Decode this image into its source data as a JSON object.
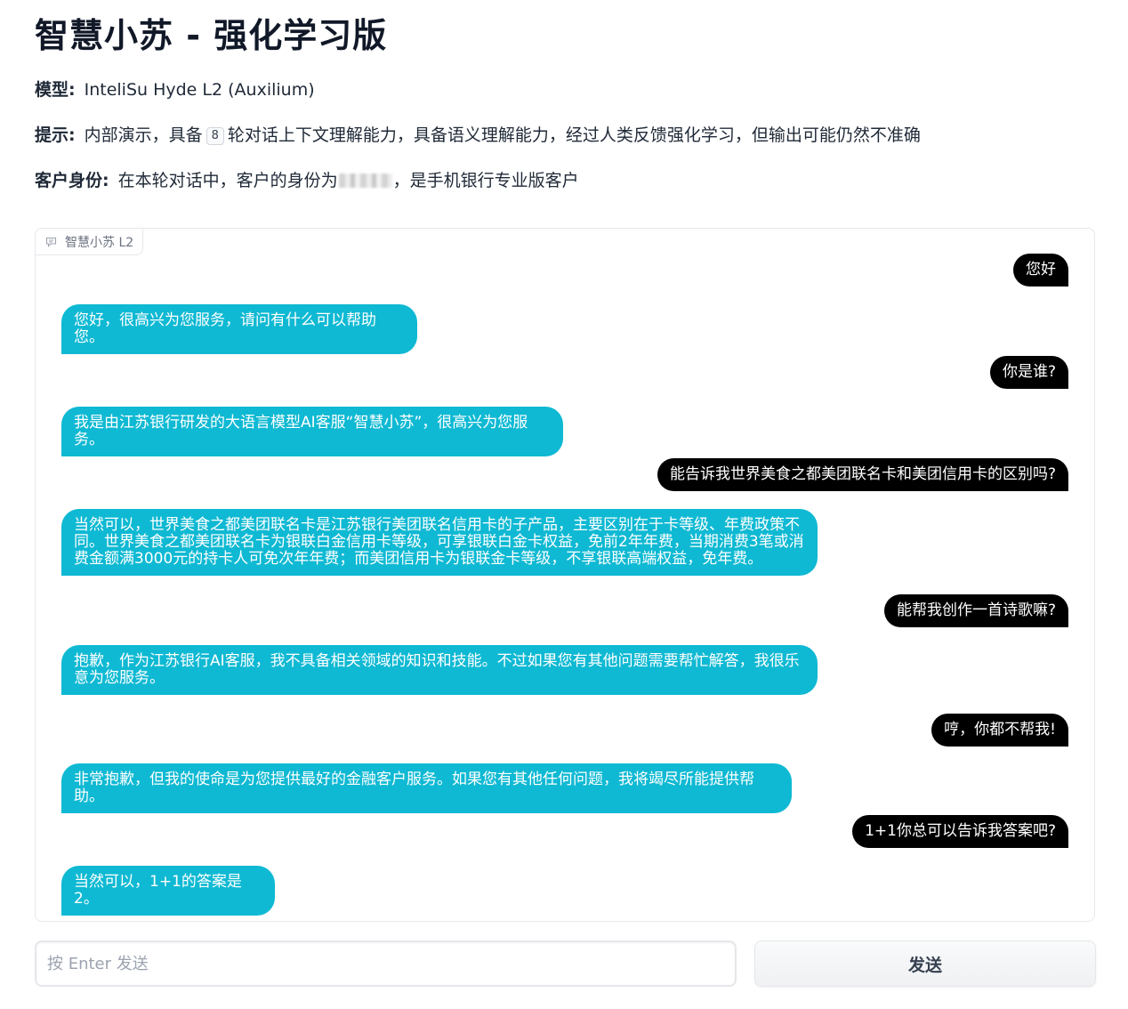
{
  "page": {
    "title": "智慧小苏 - 强化学习版"
  },
  "info": {
    "model_label": "模型:",
    "model_value": "InteliSu Hyde L2 (Auxilium)",
    "hint_label": "提示:",
    "hint_prefix": "内部演示，具备",
    "hint_turns": "8",
    "hint_suffix": "轮对话上下文理解能力，具备语义理解能力，经过人类反馈强化学习，但输出可能仍然不准确",
    "identity_label": "客户身份:",
    "identity_prefix": "在本轮对话中，客户的身份为",
    "identity_suffix": "，是手机银行专业版客户"
  },
  "chat": {
    "label": "智慧小苏 L2",
    "label_icon": "chat-bubble-icon",
    "user_bubble_color": "#000000",
    "bot_bubble_color": "#0fb9d3",
    "messages": [
      {
        "role": "user",
        "text": "您好"
      },
      {
        "role": "bot",
        "text": "您好，很高兴为您服务，请问有什么可以帮助您。"
      },
      {
        "role": "user",
        "text": "你是谁?"
      },
      {
        "role": "bot",
        "text": "我是由江苏银行研发的大语言模型AI客服“智慧小苏”，很高兴为您服务。"
      },
      {
        "role": "user",
        "text": "能告诉我世界美食之都美团联名卡和美团信用卡的区别吗?"
      },
      {
        "role": "bot",
        "text": "当然可以，世界美食之都美团联名卡是江苏银行美团联名信用卡的子产品，主要区别在于卡等级、年费政策不同。世界美食之都美团联名卡为银联白金信用卡等级，可享银联白金卡权益，免前2年年费，当期消费3笔或消费金额满3000元的持卡人可免次年年费；而美团信用卡为银联金卡等级，不享银联高端权益，免年费。"
      },
      {
        "role": "user",
        "text": "能帮我创作一首诗歌嘛?"
      },
      {
        "role": "bot",
        "text": "抱歉，作为江苏银行AI客服，我不具备相关领域的知识和技能。不过如果您有其他问题需要帮忙解答，我很乐意为您服务。"
      },
      {
        "role": "user",
        "text": "哼，你都不帮我!"
      },
      {
        "role": "bot",
        "text": "非常抱歉，但我的使命是为您提供最好的金融客户服务。如果您有其他任何问题，我将竭尽所能提供帮助。"
      },
      {
        "role": "user",
        "text": "1+1你总可以告诉我答案吧?"
      },
      {
        "role": "bot",
        "text": "当然可以，1+1的答案是2。"
      }
    ]
  },
  "composer": {
    "placeholder": "按 Enter 发送",
    "value": "",
    "send_label": "发送"
  }
}
